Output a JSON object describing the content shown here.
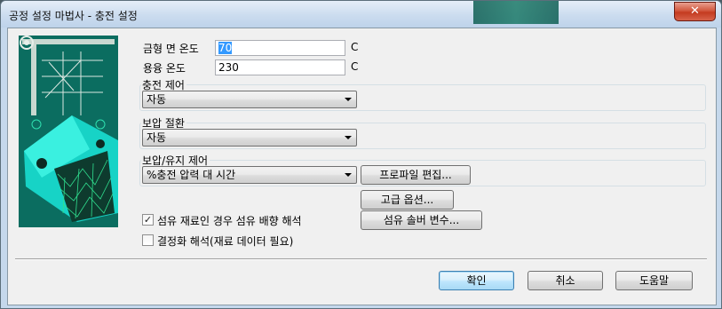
{
  "window": {
    "title": "공정 설정 마법사 - 충전 설정",
    "close_symbol": "✕"
  },
  "fields": {
    "mold_temp": {
      "label": "금형 면 온도",
      "value": "70",
      "unit": "C"
    },
    "melt_temp": {
      "label": "용융 온도",
      "value": "230",
      "unit": "C"
    }
  },
  "fill_control": {
    "label": "충전 제어",
    "selected": "자동"
  },
  "velocity_pressure_switch": {
    "label": "보압 절환",
    "selected": "자동"
  },
  "pack_holding": {
    "label": "보압/유지 제어",
    "selected": "%충전 압력 대 시간",
    "profile_button": "프로파일 편집..."
  },
  "advanced_button": "고급 옵션...",
  "fiber_solver_button": "섬유 솔버 변수...",
  "checkboxes": {
    "fiber": {
      "label": "섬유 재료인 경우 섬유 배향 해석",
      "checked": true,
      "mark": "✓"
    },
    "crystallization": {
      "label": "결정화 해석(재료 데이터 필요)",
      "checked": false,
      "mark": ""
    }
  },
  "footer": {
    "ok": "확인",
    "cancel": "취소",
    "help": "도움말"
  },
  "colors": {
    "illustration_bg": "#0b6d60",
    "accent": "#2fe0b0"
  }
}
